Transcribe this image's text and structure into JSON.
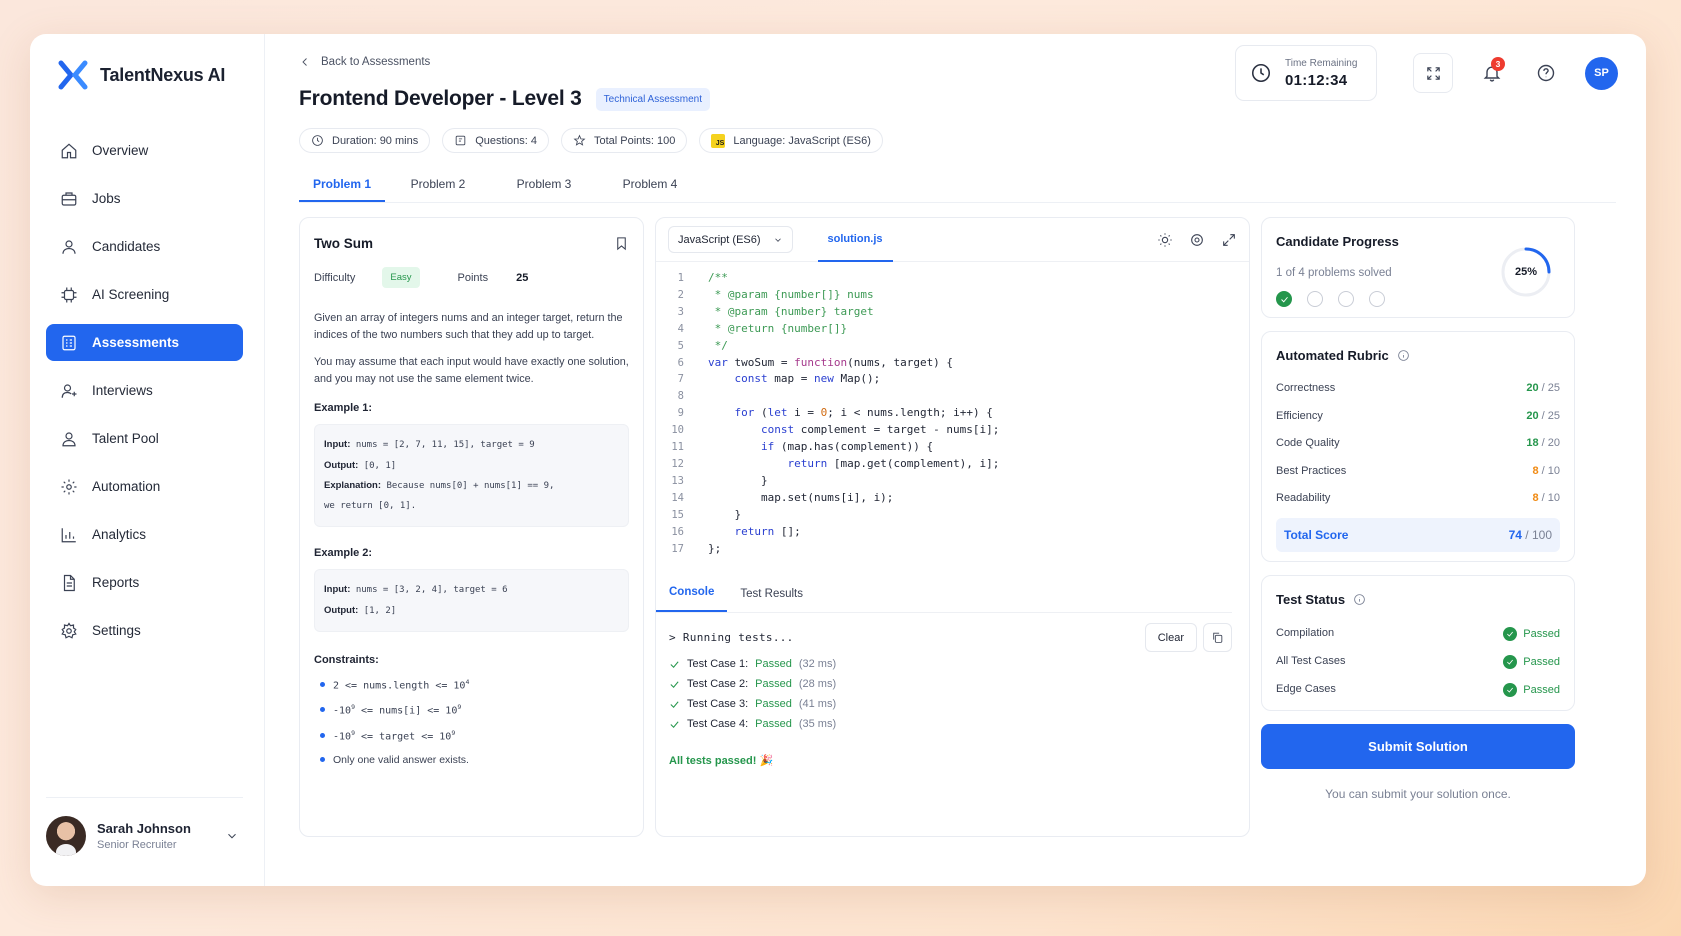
{
  "brand": {
    "name": "TalentNexus AI",
    "accent": "#2266ee"
  },
  "sidebar": {
    "items": [
      {
        "label": "Overview",
        "icon": "home-icon"
      },
      {
        "label": "Jobs",
        "icon": "briefcase-icon"
      },
      {
        "label": "Candidates",
        "icon": "user-icon"
      },
      {
        "label": "AI Screening",
        "icon": "ai-chip-icon"
      },
      {
        "label": "Assessments",
        "icon": "clipboard-icon",
        "active": true
      },
      {
        "label": "Interviews",
        "icon": "user-plus-icon"
      },
      {
        "label": "Talent Pool",
        "icon": "users-icon"
      },
      {
        "label": "Automation",
        "icon": "cog-flow-icon"
      },
      {
        "label": "Analytics",
        "icon": "bar-chart-icon"
      },
      {
        "label": "Reports",
        "icon": "document-icon"
      },
      {
        "label": "Settings",
        "icon": "gear-icon"
      }
    ],
    "user": {
      "name": "Sarah Johnson",
      "role": "Senior Recruiter"
    }
  },
  "header": {
    "back_label": "Back to Assessments",
    "title": "Frontend Developer - Level 3",
    "tag": "Technical Assessment",
    "meta": {
      "duration": "Duration: 90 mins",
      "questions": "Questions: 4",
      "points": "Total Points: 100",
      "language": "Language: JavaScript (ES6)",
      "js_badge": "JS"
    },
    "timer": {
      "label": "Time Remaining",
      "value": "01:12:34"
    },
    "notifications": "3",
    "avatar_initials": "SP"
  },
  "tabs": [
    "Problem 1",
    "Problem 2",
    "Problem 3",
    "Problem 4"
  ],
  "problem": {
    "title": "Two Sum",
    "difficulty_label": "Difficulty",
    "difficulty": "Easy",
    "points_label": "Points",
    "points": "25",
    "desc1": "Given an array of integers nums and an integer target, return the indices of the two numbers such that they add up to target.",
    "desc2": "You may assume that each input would have exactly one solution, and you may not use the same element twice.",
    "example1_label": "Example 1:",
    "example1": {
      "input_label": "Input:",
      "input": "nums = [2, 7, 11, 15], target = 9",
      "output_label": "Output:",
      "output": "[0, 1]",
      "expl_label": "Explanation:",
      "expl": "Because  nums[0] + nums[1] == 9,",
      "expl2": "we return [0, 1]."
    },
    "example2_label": "Example 2:",
    "example2": {
      "input_label": "Input:",
      "input": "nums = [3, 2, 4], target = 6",
      "output_label": "Output:",
      "output": "[1, 2]"
    },
    "constraints_label": "Constraints:",
    "constraints": {
      "c1": "2 <= nums.length <= 10",
      "c1_exp": "4",
      "c2a": "-10",
      "c2a_exp": "9",
      "c2b": " <= nums[i] <= 10",
      "c2b_exp": "9",
      "c3a": "-10",
      "c3a_exp": "9",
      "c3b": " <= target <= 10",
      "c3b_exp": "9",
      "c4": "Only one valid answer exists."
    }
  },
  "editor": {
    "language": "JavaScript (ES6)",
    "file": "solution.js",
    "lines": [
      "/**",
      " * @param {number[]} nums",
      " * @param {number} target",
      " * @return {number[]}",
      " */",
      "var twoSum = function(nums, target) {",
      "    const map = new Map();",
      "",
      "    for (let i = 0; i < nums.length; i++) {",
      "        const complement = target - nums[i];",
      "        if (map.has(complement)) {",
      "            return [map.get(complement), i];",
      "        }",
      "        map.set(nums[i], i);",
      "    }",
      "    return [];",
      "};"
    ]
  },
  "console": {
    "tabs": [
      "Console",
      "Test Results"
    ],
    "running": "> Running tests...",
    "clear_label": "Clear",
    "tests": [
      {
        "name": "Test Case 1:",
        "status": "Passed",
        "time": "(32 ms)"
      },
      {
        "name": "Test Case 2:",
        "status": "Passed",
        "time": "(28 ms)"
      },
      {
        "name": "Test Case 3:",
        "status": "Passed",
        "time": "(41 ms)"
      },
      {
        "name": "Test Case 4:",
        "status": "Passed",
        "time": "(35 ms)"
      }
    ],
    "summary": "All tests passed! 🎉"
  },
  "progress": {
    "title": "Candidate Progress",
    "subtitle": "1 of 4 problems solved",
    "percent_label": "25%",
    "fraction": 0.25
  },
  "rubric": {
    "title": "Automated Rubric",
    "rows": [
      {
        "label": "Correctness",
        "score": "20",
        "max": " / 25",
        "level": "good"
      },
      {
        "label": "Efficiency",
        "score": "20",
        "max": " / 25",
        "level": "good"
      },
      {
        "label": "Code Quality",
        "score": "18",
        "max": " / 20",
        "level": "good"
      },
      {
        "label": "Best Practices",
        "score": "8",
        "max": " / 10",
        "level": "mid"
      },
      {
        "label": "Readability",
        "score": "8",
        "max": " / 10",
        "level": "mid"
      }
    ],
    "total_label": "Total Score",
    "total": "74",
    "total_max": " / 100"
  },
  "test_status": {
    "title": "Test Status",
    "rows": [
      {
        "label": "Compilation",
        "status": "Passed"
      },
      {
        "label": "All Test Cases",
        "status": "Passed"
      },
      {
        "label": "Edge Cases",
        "status": "Passed"
      }
    ]
  },
  "submit": {
    "label": "Submit Solution",
    "note": "You can submit your solution once."
  }
}
